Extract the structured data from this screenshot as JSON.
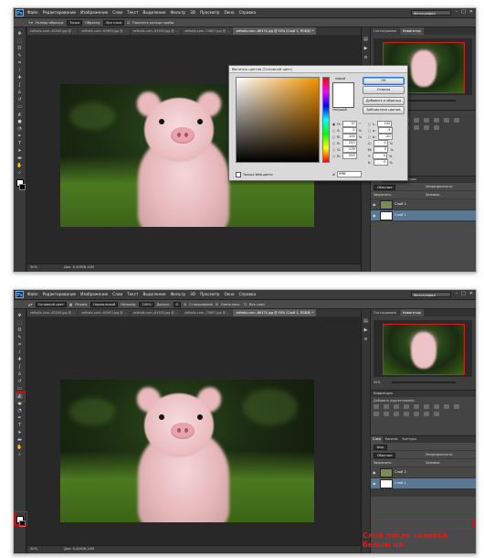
{
  "app": {
    "logo": "Ps"
  },
  "menu": [
    "Файл",
    "Редактирование",
    "Изображение",
    "Слои",
    "Текст",
    "Выделение",
    "Фильтр",
    "3D",
    "Просмотр",
    "Окно",
    "Справка"
  ],
  "workspace": "Фотография",
  "shot1": {
    "options": [
      "Размер образца:",
      "Точка",
      "Образец:",
      "Все слои",
      "Показать кольцо пробы"
    ],
    "tabs": [
      {
        "label": "zefkalls.com--62049.jpg @ ...",
        "active": false
      },
      {
        "label": "zefkalls.com--61963.jpg @ ...",
        "active": false
      },
      {
        "label": "zefkalls.com--61933.jpg @ ...",
        "active": false
      },
      {
        "label": "zefkalls.com--70807.jpg @ ...",
        "active": false
      },
      {
        "label": "zefkalls.com--66174.jpg @ 50% (Слой 1, RGB/8) *",
        "active": true
      }
    ],
    "status_zoom": "50%",
    "status_doc": "Док: 6,42M/6,14M",
    "panel_tabs": [
      {
        "label": "Гистограмма",
        "on": false
      },
      {
        "label": "Навигатор",
        "on": true
      }
    ],
    "zoom_value": "50%",
    "layers_tabs": [
      "Слои",
      "Каналы",
      "Контуры"
    ],
    "blend_mode": "Обычные",
    "opacity_label": "Непрозрачность:",
    "lock_label": "Закрепить:",
    "fill_label": "Заливка:",
    "layers": [
      {
        "name": "Слой 2",
        "sel": false,
        "thumb": "#7a8a5a"
      },
      {
        "name": "Слой 1",
        "sel": true,
        "thumb": "#ffffff"
      }
    ],
    "dialog": {
      "title": "Палитра цветов (Основной цвет)",
      "new_label": "новый",
      "current_label": "текущий",
      "buttons": [
        "ОК",
        "Отмена",
        "Добавить в образцы",
        "Библиотеки цветов"
      ],
      "hsb": [
        {
          "k": "H:",
          "v": "37",
          "u": "°"
        },
        {
          "k": "S:",
          "v": "0",
          "u": "%"
        },
        {
          "k": "B:",
          "v": "100",
          "u": "%"
        }
      ],
      "rgb": [
        {
          "k": "R:",
          "v": "255"
        },
        {
          "k": "G:",
          "v": "255"
        },
        {
          "k": "B:",
          "v": "255"
        }
      ],
      "lab": [
        {
          "k": "L:",
          "v": "100"
        },
        {
          "k": "a:",
          "v": "-5"
        },
        {
          "k": "b:",
          "v": "-20"
        }
      ],
      "cmyk": [
        {
          "k": "C:",
          "v": "0",
          "u": "%"
        },
        {
          "k": "M:",
          "v": "0",
          "u": "%"
        },
        {
          "k": "Y:",
          "v": "0",
          "u": "%"
        },
        {
          "k": "K:",
          "v": "0",
          "u": "%"
        }
      ],
      "hex_label": "#",
      "hex_value": "ffffff",
      "websafe": "Только Web-цвета"
    }
  },
  "shot2": {
    "options": [
      "Основной цвет",
      "Режим:",
      "Нормальный",
      "Непрозр:",
      "100%",
      "Допуск:",
      "0",
      "Сглаживание",
      "Смеж.пикс.",
      "Все слои"
    ],
    "tabs": [
      {
        "label": "zefkalls.com--62049.jpg @ ...",
        "active": false
      },
      {
        "label": "zefkalls.com--61963.jpg @ ...",
        "active": false
      },
      {
        "label": "zefkalls.com--61933.jpg @ ...",
        "active": false
      },
      {
        "label": "zefkalls.com--70807.jpg @ ...",
        "active": false
      },
      {
        "label": "zefkalls.com--66174.jpg @ 50% (Слой 1, RGB/8) *",
        "active": true
      }
    ],
    "status_zoom": "50%",
    "status_doc": "Док: 6,42M/6,14M",
    "panel_tabs": [
      {
        "label": "Гистограмма",
        "on": false
      },
      {
        "label": "Навигатор",
        "on": true
      }
    ],
    "zoom_value": "50%",
    "adj_title": "Коррекция",
    "adj_label": "Добавить корректировку",
    "layers_tabs": [
      "Слои",
      "Каналы",
      "Контуры"
    ],
    "kind": "Вид",
    "blend_mode": "Обычные",
    "opacity_label": "Непрозрачность:",
    "lock_label": "Закрепить:",
    "fill_label": "Заливка:",
    "layers": [
      {
        "name": "Слой 2",
        "sel": false,
        "thumb": "#7a8a5a"
      },
      {
        "name": "Слой 1",
        "sel": true,
        "thumb": "#ffffff"
      }
    ],
    "annotation": "Слой после заливки белым цв."
  },
  "colors": {
    "accent_red": "#e01010",
    "selected_layer": "#5a7894"
  }
}
